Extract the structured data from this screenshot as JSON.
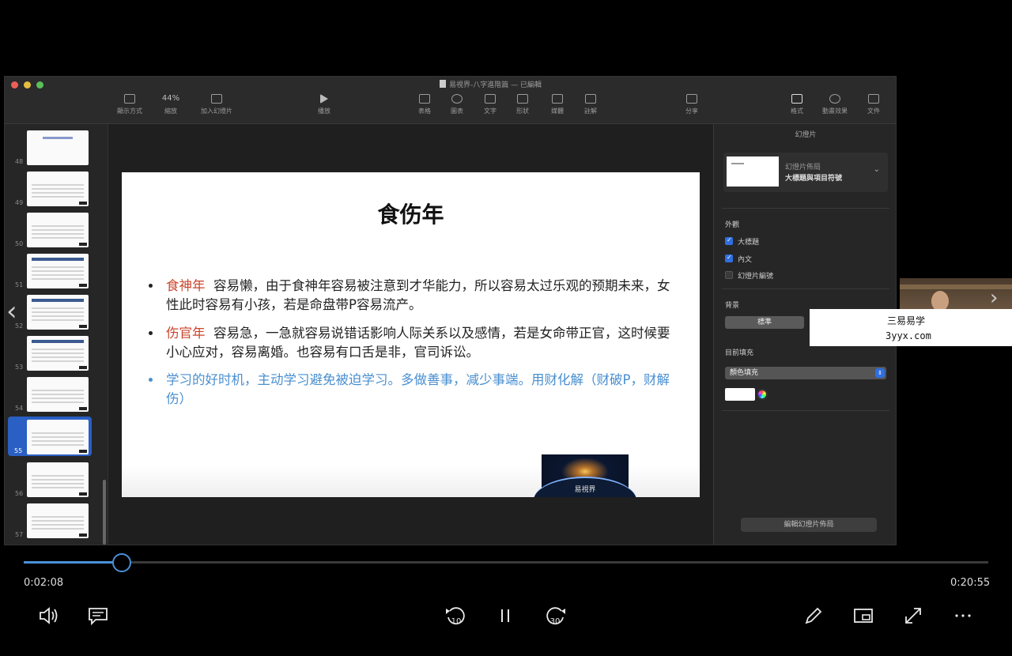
{
  "keynote": {
    "doc_title": "易視界-八字進階篇 — 已編輯",
    "toolbar": [
      {
        "label": "顯示方式",
        "icon": "view-icon"
      },
      {
        "label": "縮放",
        "value": "44%",
        "icon": "zoom-icon"
      },
      {
        "label": "加入幻燈片",
        "icon": "add-slide-icon"
      },
      {
        "label": "播放",
        "icon": "play-icon"
      },
      {
        "label": "表格",
        "icon": "table-icon"
      },
      {
        "label": "圖表",
        "icon": "chart-icon"
      },
      {
        "label": "文字",
        "icon": "text-icon"
      },
      {
        "label": "形狀",
        "icon": "shape-icon"
      },
      {
        "label": "媒體",
        "icon": "media-icon"
      },
      {
        "label": "註解",
        "icon": "comment-icon"
      },
      {
        "label": "分享",
        "icon": "share-icon"
      },
      {
        "label": "格式",
        "icon": "format-icon"
      },
      {
        "label": "動畫效果",
        "icon": "animate-icon"
      },
      {
        "label": "文件",
        "icon": "document-icon"
      }
    ],
    "slide_numbers": [
      "48",
      "49",
      "50",
      "51",
      "52",
      "53",
      "54",
      "55",
      "56",
      "57"
    ],
    "selected_slide": "55",
    "slide": {
      "title": "食伤年",
      "bullets": [
        {
          "keyword": "食神年",
          "text": "容易懒，由于食神年容易被注意到才华能力，所以容易太过乐观的预期未来，女性此时容易有小孩，若是命盘带P容易流产。"
        },
        {
          "keyword": "伤官年",
          "text": "容易急，一急就容易说错话影响人际关系以及感情，若是女命带正官，这时候要小心应对，容易离婚。也容易有口舌是非，官司诉讼。"
        },
        {
          "keyword": "",
          "text": "学习的好时机，主动学习避免被迫学习。多做善事，减少事端。用财化解（财破P，财解伤）"
        }
      ],
      "logo_text": "易視界"
    },
    "inspector": {
      "tab": "幻燈片",
      "layout_label": "幻燈片佈局",
      "layout_name": "大標題與項目符號",
      "appearance_label": "外觀",
      "checks": [
        {
          "label": "大標題",
          "checked": true
        },
        {
          "label": "內文",
          "checked": true
        },
        {
          "label": "幻燈片編號",
          "checked": false
        }
      ],
      "background_label": "背景",
      "standard_button": "標準",
      "current_fill_label": "目前填充",
      "fill_option": "顏色填充",
      "edit_layout_button": "編輯幻燈片佈局"
    }
  },
  "watermark": {
    "line1": "三易易学",
    "line2": "3yyx.com"
  },
  "player": {
    "current_time": "0:02:08",
    "total_time": "0:20:55",
    "progress": 0.102,
    "skip_back": "10",
    "skip_forward": "30",
    "accent_color": "#4a90d9"
  }
}
